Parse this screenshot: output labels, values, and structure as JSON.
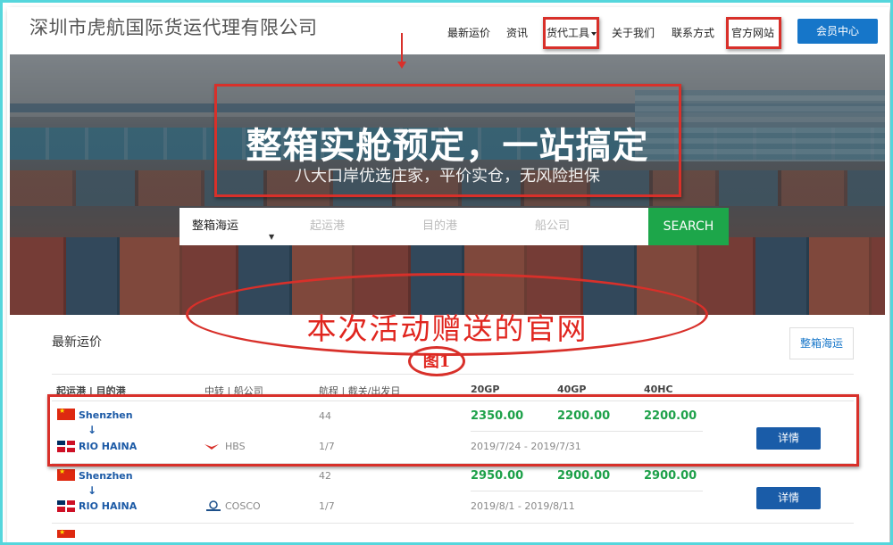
{
  "header": {
    "site_title": "深圳市虎航国际货运代理有限公司",
    "nav": {
      "latest_rates": "最新运价",
      "news": "资讯",
      "tools": "货代工具",
      "about": "关于我们",
      "contact": "联系方式",
      "official_site": "官方网站"
    },
    "member_center": "会员中心"
  },
  "hero": {
    "headline": "整箱实舱预定，一站搞定",
    "subheadline": "八大口岸优选庄家，平价实仓，无风险担保",
    "search": {
      "mode": "整箱海运",
      "origin_placeholder": "起运港",
      "destination_placeholder": "目的港",
      "carrier_placeholder": "船公司",
      "button": "SEARCH"
    }
  },
  "annotation": {
    "promo_text": "本次活动赠送的官网",
    "figure_label": "图1"
  },
  "rates": {
    "title": "最新运价",
    "tab": "整箱海运",
    "columns": {
      "route": "起运港 | 目的港",
      "transit": "中转 | 船公司",
      "voyage": "航程 | 截关/出发日",
      "gp20": "20GP",
      "gp40": "40GP",
      "hc40": "40HC"
    },
    "rows": [
      {
        "origin": "Shenzhen",
        "destination": "RIO HAINA",
        "carrier": "HBS",
        "days": "44",
        "schedule": "1/7",
        "gp20": "2350.00",
        "gp40": "2200.00",
        "hc40": "2200.00",
        "dates": "2019/7/24 - 2019/7/31",
        "action": "详情"
      },
      {
        "origin": "Shenzhen",
        "destination": "RIO HAINA",
        "carrier": "COSCO",
        "days": "42",
        "schedule": "1/7",
        "gp20": "2950.00",
        "gp40": "2900.00",
        "hc40": "2900.00",
        "dates": "2019/8/1 - 2019/8/11",
        "action": "详情"
      }
    ]
  },
  "colors": {
    "primary_blue": "#1676c9",
    "search_green": "#1da64a",
    "price_green": "#1ea14a",
    "annotation_red": "#d8302a"
  }
}
